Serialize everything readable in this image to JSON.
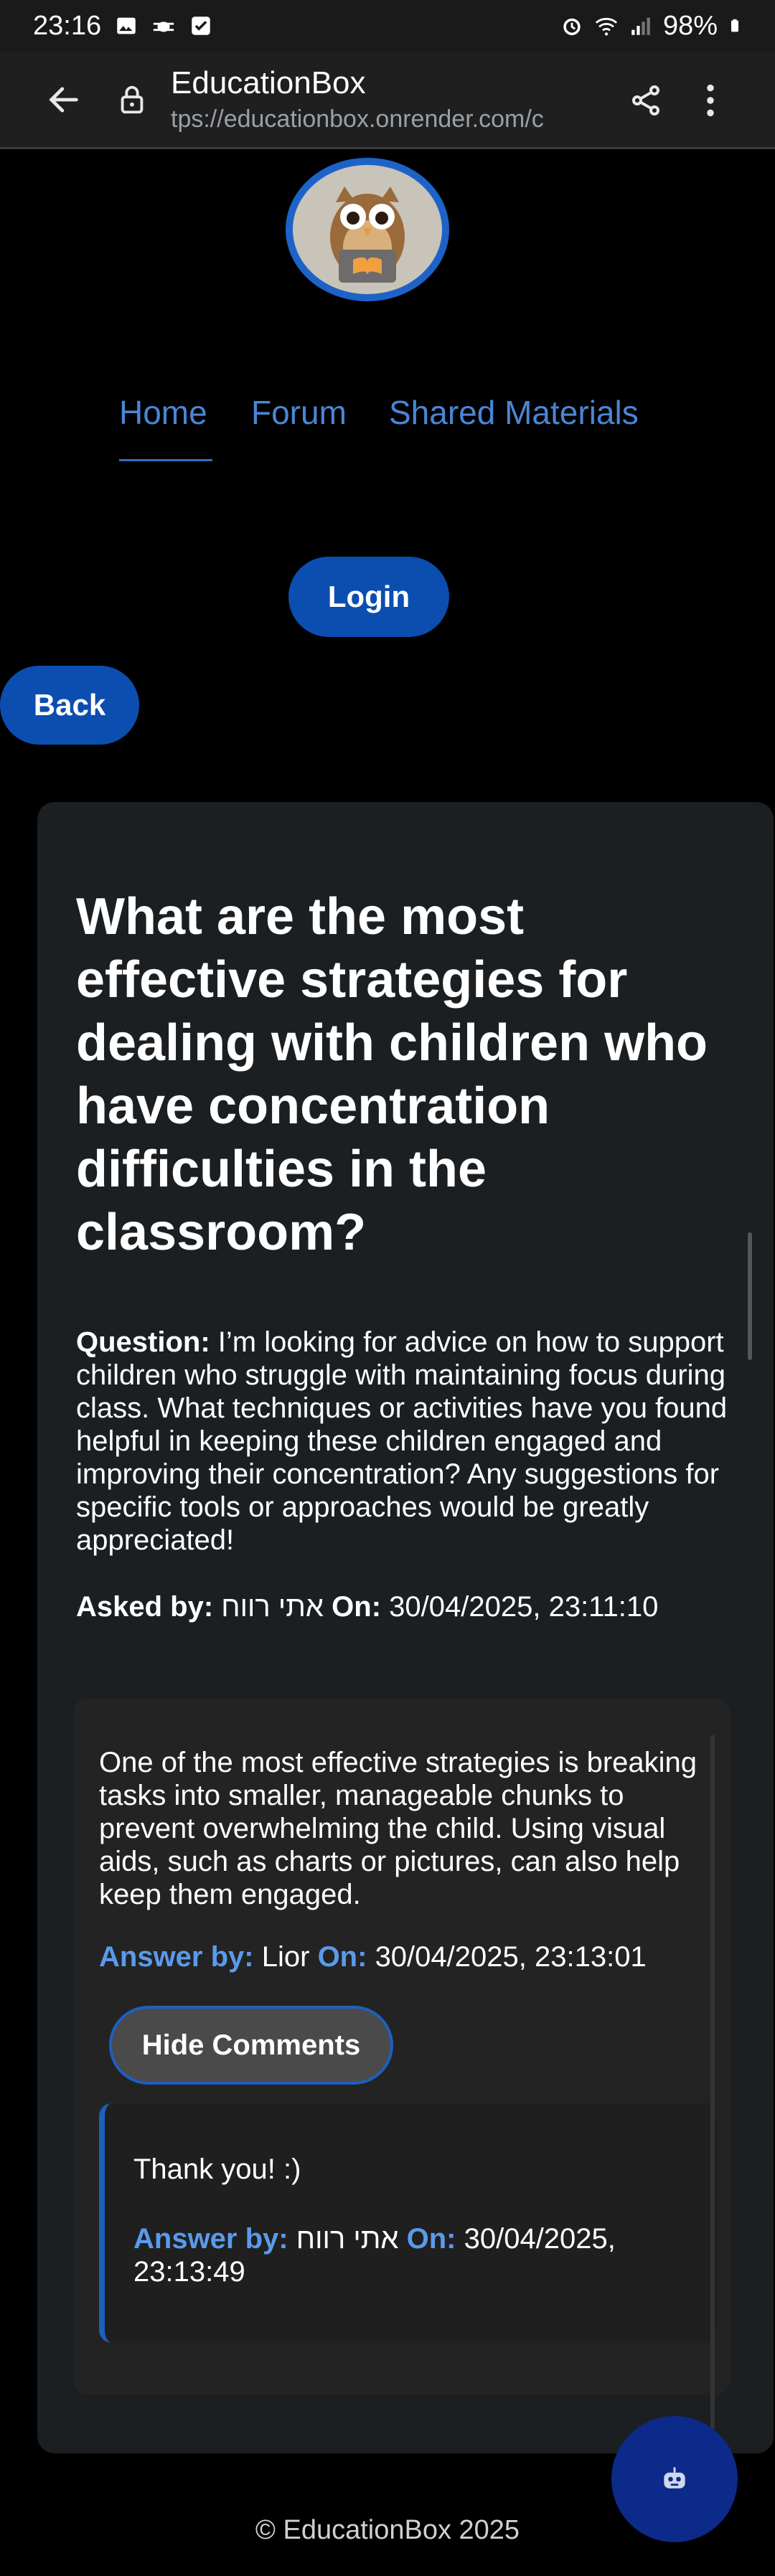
{
  "status_bar": {
    "time": "23:16",
    "battery": "98%"
  },
  "browser": {
    "title": "EducationBox",
    "url": "tps://educationbox.onrender.com/c"
  },
  "nav": {
    "home": "Home",
    "forum": "Forum",
    "shared": "Shared Materials"
  },
  "buttons": {
    "login": "Login",
    "back": "Back",
    "hide_comments": "Hide Comments"
  },
  "question": {
    "title": "What are the most effective strategies for dealing with children who have concentration difficulties in the classroom?",
    "label": "Question:",
    "body": "I’m looking for advice on how to support children who struggle with maintaining focus during class. What techniques or activities have you found helpful in keeping these children engaged and improving their concentration? Any suggestions for specific tools or approaches would be greatly appreciated!",
    "asked_by_label": "Asked by:",
    "author": "אתי רווח",
    "on_label": "On:",
    "date": "30/04/2025, 23:11:10"
  },
  "answer": {
    "text": "One of the most effective strategies is breaking tasks into smaller, manageable chunks to prevent overwhelming the child. Using visual aids, such as charts or pictures, can also help keep them engaged.",
    "by_label": "Answer by:",
    "author": "Lior",
    "on_label": "On:",
    "date": "30/04/2025, 23:13:01"
  },
  "comment": {
    "text": "Thank you! :)",
    "by_label": "Answer by:",
    "author": "אתי רווח",
    "on_label": "On:",
    "date": "30/04/2025, 23:13:49"
  },
  "footer": "© EducationBox 2025",
  "colors": {
    "accent": "#5a9aeb",
    "primary_button": "#0b4eb0",
    "card": "#1b1f22"
  },
  "icons": [
    "back-arrow-icon",
    "lock-icon",
    "share-icon",
    "more-vert-icon",
    "owl-logo",
    "chatbot-icon"
  ]
}
